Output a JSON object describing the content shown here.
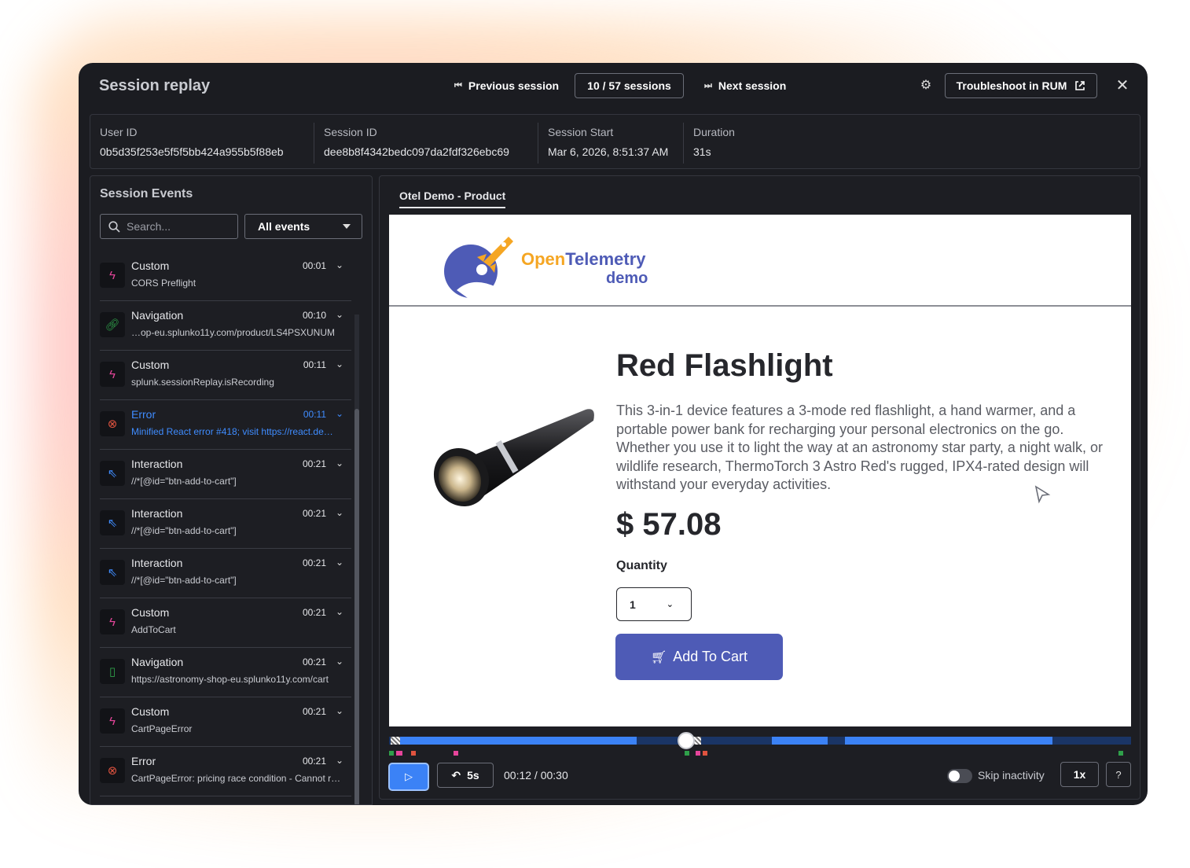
{
  "header": {
    "title": "Session replay",
    "prev_label": "Previous session",
    "sessions_label": "10 / 57 sessions",
    "next_label": "Next session",
    "troubleshoot_label": "Troubleshoot in RUM"
  },
  "info": {
    "user_id_label": "User ID",
    "user_id": "0b5d35f253e5f5f5bb424a955b5f88eb",
    "session_id_label": "Session ID",
    "session_id": "dee8b8f4342bedc097da2fdf326ebc69",
    "start_label": "Session Start",
    "start": "Mar 6, 2026, 8:51:37 AM",
    "duration_label": "Duration",
    "duration": "31s"
  },
  "events": {
    "title": "Session Events",
    "search_placeholder": "Search...",
    "filter_value": "All events",
    "items": [
      {
        "type": "Custom",
        "time": "00:01",
        "desc": "CORS Preflight"
      },
      {
        "type": "Navigation",
        "time": "00:10",
        "desc": "…op-eu.splunko11y.com/product/LS4PSXUNUM"
      },
      {
        "type": "Custom",
        "time": "00:11",
        "desc": "splunk.sessionReplay.isRecording"
      },
      {
        "type": "Error",
        "time": "00:11",
        "desc": "Minified React error #418; visit https://react.de…"
      },
      {
        "type": "Interaction",
        "time": "00:21",
        "desc": "//*[@id=\"btn-add-to-cart\"]"
      },
      {
        "type": "Interaction",
        "time": "00:21",
        "desc": "//*[@id=\"btn-add-to-cart\"]"
      },
      {
        "type": "Interaction",
        "time": "00:21",
        "desc": "//*[@id=\"btn-add-to-cart\"]"
      },
      {
        "type": "Custom",
        "time": "00:21",
        "desc": "AddToCart"
      },
      {
        "type": "Navigation",
        "time": "00:21",
        "desc": "https://astronomy-shop-eu.splunko11y.com/cart"
      },
      {
        "type": "Custom",
        "time": "00:21",
        "desc": "CartPageError"
      },
      {
        "type": "Error",
        "time": "00:21",
        "desc": "CartPageError: pricing race condition - Cannot r…"
      }
    ]
  },
  "replay": {
    "tab": "Otel Demo - Product",
    "logo_open": "Open",
    "logo_telemetry": "Telemetry",
    "logo_demo": "demo",
    "product_title": "Red Flashlight",
    "product_desc": "This 3-in-1 device features a 3-mode red flashlight, a hand warmer, and a portable power bank for recharging your personal electronics on the go. Whether you use it to light the way at an astronomy star party, a night walk, or wildlife research, ThermoTorch 3 Astro Red's rugged, IPX4-rated design will withstand your everyday activities.",
    "price": "$ 57.08",
    "quantity_label": "Quantity",
    "quantity_value": "1",
    "add_to_cart": "Add To Cart"
  },
  "player": {
    "skip_label": "5s",
    "time": "00:12 / 00:30",
    "playhead_fraction": 0.4,
    "skip_inactivity_label": "Skip inactivity",
    "skip_inactivity_on": false,
    "speed": "1x"
  },
  "colors": {
    "accent": "#3b82f6",
    "error": "#3f8cff",
    "brand_orange": "#f5a623",
    "brand_blue": "#4e5bb6"
  }
}
